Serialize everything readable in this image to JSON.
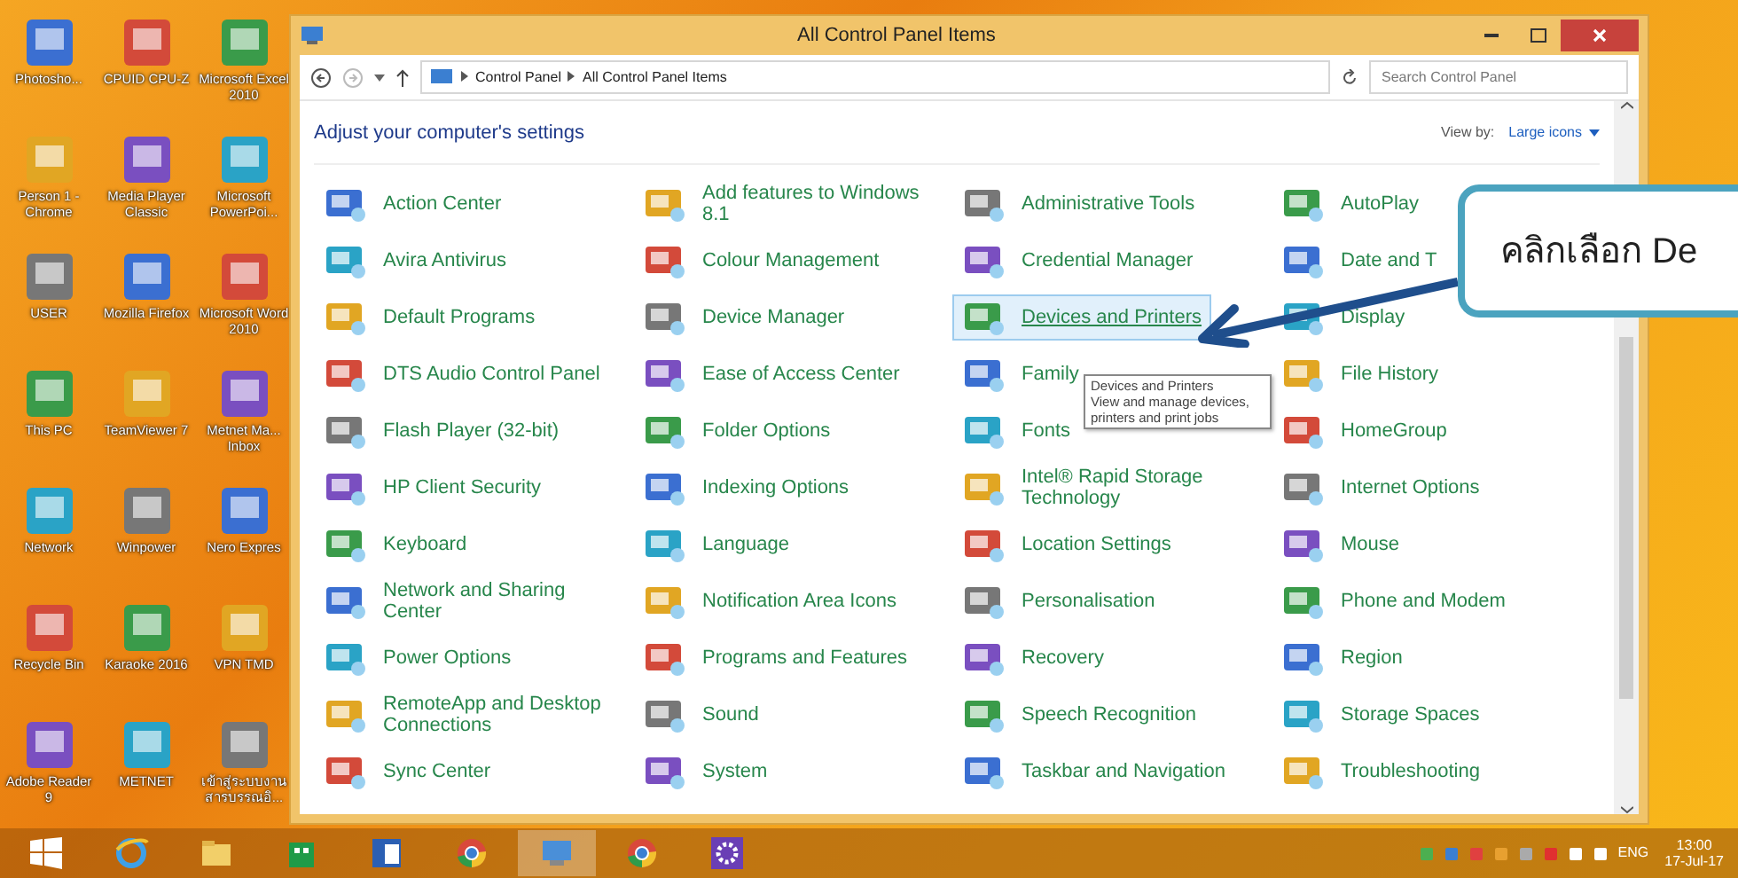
{
  "desktop_icons": [
    {
      "label": "Photosho..."
    },
    {
      "label": "CPUID CPU-Z"
    },
    {
      "label": "Microsoft Excel 2010"
    },
    {
      "label": "Person 1 - Chrome"
    },
    {
      "label": "Media Player Classic"
    },
    {
      "label": "Microsoft PowerPoi..."
    },
    {
      "label": "USER"
    },
    {
      "label": "Mozilla Firefox"
    },
    {
      "label": "Microsoft Word 2010"
    },
    {
      "label": "This PC"
    },
    {
      "label": "TeamViewer 7"
    },
    {
      "label": "Metnet Ma... Inbox"
    },
    {
      "label": "Network"
    },
    {
      "label": "Winpower"
    },
    {
      "label": "Nero Expres"
    },
    {
      "label": "Recycle Bin"
    },
    {
      "label": "Karaoke 2016"
    },
    {
      "label": "VPN TMD"
    },
    {
      "label": "Adobe Reader 9"
    },
    {
      "label": "METNET"
    },
    {
      "label": "เข้าสู่ระบบงาน สารบรรณอิ..."
    }
  ],
  "window": {
    "title": "All Control Panel Items",
    "address": {
      "crumbs": [
        "Control Panel",
        "All Control Panel Items"
      ]
    },
    "search": {
      "placeholder": "Search Control Panel"
    },
    "heading": "Adjust your computer's settings",
    "view_by": {
      "label": "View by:",
      "value": "Large icons"
    },
    "items": [
      {
        "label": "Action Center",
        "selected": false
      },
      {
        "label": "Add features to Windows 8.1",
        "selected": false
      },
      {
        "label": "Administrative Tools",
        "selected": false
      },
      {
        "label": "AutoPlay",
        "selected": false
      },
      {
        "label": "Avira Antivirus",
        "selected": false
      },
      {
        "label": "Colour Management",
        "selected": false
      },
      {
        "label": "Credential Manager",
        "selected": false
      },
      {
        "label": "Date and T",
        "selected": false
      },
      {
        "label": "Default Programs",
        "selected": false
      },
      {
        "label": "Device Manager",
        "selected": false
      },
      {
        "label": "Devices and Printers",
        "selected": true
      },
      {
        "label": "Display",
        "selected": false
      },
      {
        "label": "DTS Audio Control Panel",
        "selected": false
      },
      {
        "label": "Ease of Access Center",
        "selected": false
      },
      {
        "label": "Family",
        "selected": false
      },
      {
        "label": "File History",
        "selected": false
      },
      {
        "label": "Flash Player (32-bit)",
        "selected": false
      },
      {
        "label": "Folder Options",
        "selected": false
      },
      {
        "label": "Fonts",
        "selected": false
      },
      {
        "label": "HomeGroup",
        "selected": false
      },
      {
        "label": "HP Client Security",
        "selected": false
      },
      {
        "label": "Indexing Options",
        "selected": false
      },
      {
        "label": "Intel® Rapid Storage Technology",
        "selected": false
      },
      {
        "label": "Internet Options",
        "selected": false
      },
      {
        "label": "Keyboard",
        "selected": false
      },
      {
        "label": "Language",
        "selected": false
      },
      {
        "label": "Location Settings",
        "selected": false
      },
      {
        "label": "Mouse",
        "selected": false
      },
      {
        "label": "Network and Sharing Center",
        "selected": false
      },
      {
        "label": "Notification Area Icons",
        "selected": false
      },
      {
        "label": "Personalisation",
        "selected": false
      },
      {
        "label": "Phone and Modem",
        "selected": false
      },
      {
        "label": "Power Options",
        "selected": false
      },
      {
        "label": "Programs and Features",
        "selected": false
      },
      {
        "label": "Recovery",
        "selected": false
      },
      {
        "label": "Region",
        "selected": false
      },
      {
        "label": "RemoteApp and Desktop Connections",
        "selected": false
      },
      {
        "label": "Sound",
        "selected": false
      },
      {
        "label": "Speech Recognition",
        "selected": false
      },
      {
        "label": "Storage Spaces",
        "selected": false
      },
      {
        "label": "Sync Center",
        "selected": false
      },
      {
        "label": "System",
        "selected": false
      },
      {
        "label": "Taskbar and Navigation",
        "selected": false
      },
      {
        "label": "Troubleshooting",
        "selected": false
      }
    ],
    "tooltip": {
      "title": "Devices and Printers",
      "text": "View and manage devices, printers and print jobs"
    }
  },
  "callout": {
    "text": "คลิกเลือก De"
  },
  "taskbar": {
    "apps": [
      {
        "kind": "ie",
        "selected": false
      },
      {
        "kind": "explorer",
        "selected": false
      },
      {
        "kind": "store",
        "selected": false
      },
      {
        "kind": "word",
        "selected": false
      },
      {
        "kind": "chrome",
        "selected": false
      },
      {
        "kind": "controlpanel",
        "selected": true
      },
      {
        "kind": "chrome",
        "selected": false
      },
      {
        "kind": "settings",
        "selected": false
      }
    ],
    "language": "ENG",
    "time": "13:00",
    "date": "17-Jul-17"
  }
}
